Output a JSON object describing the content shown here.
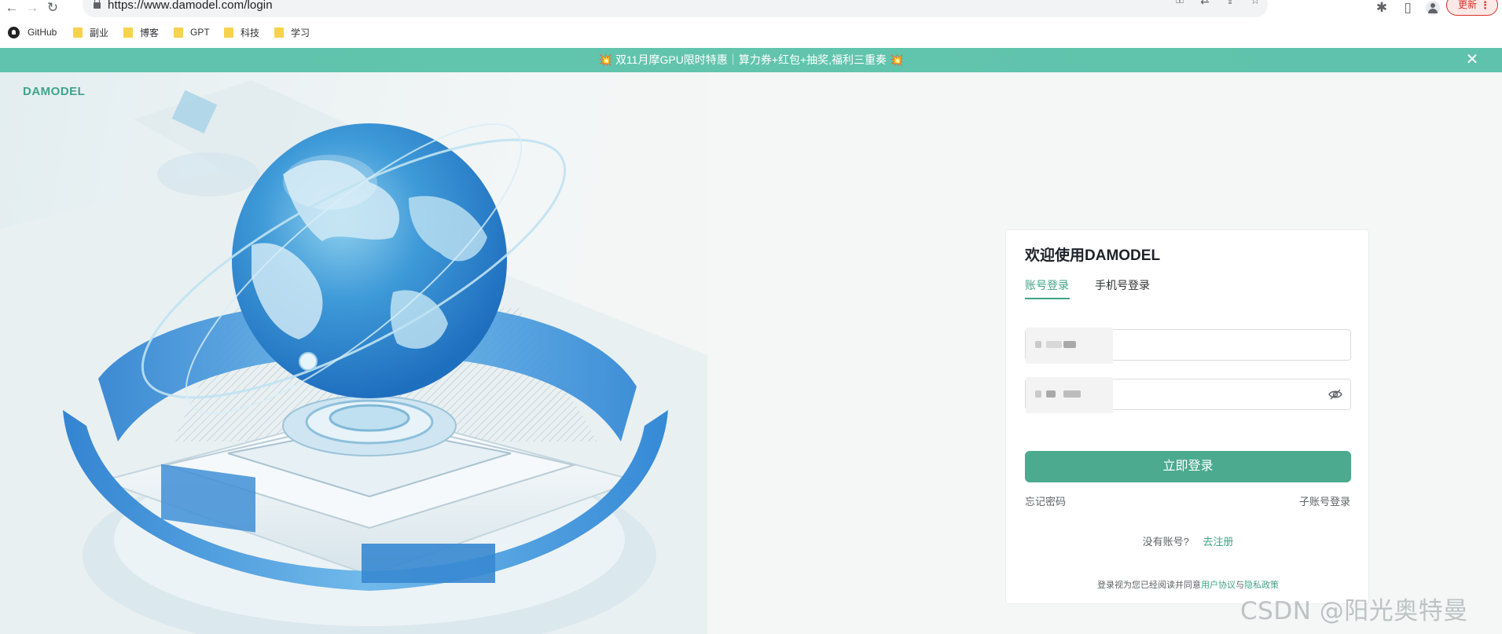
{
  "browser": {
    "url": "https://www.damodel.com/login",
    "update_label": "更新",
    "update_more": "⋮",
    "bookmarks": [
      {
        "label": "GitHub",
        "icon": "github-icon"
      },
      {
        "label": "副业",
        "icon": "folder-icon"
      },
      {
        "label": "博客",
        "icon": "folder-icon"
      },
      {
        "label": "GPT",
        "icon": "folder-icon"
      },
      {
        "label": "科技",
        "icon": "folder-icon"
      },
      {
        "label": "学习",
        "icon": "folder-icon"
      }
    ]
  },
  "banner": {
    "emoji": "💥",
    "text": "双11月摩GPU限时特惠｜算力券+红包+抽奖,福利三重奏",
    "close": "✕"
  },
  "brand": "DAMODEL",
  "login": {
    "title": "欢迎使用DAMODEL",
    "tabs": [
      {
        "label": "账号登录",
        "active": true
      },
      {
        "label": "手机号登录",
        "active": false
      }
    ],
    "submit": "立即登录",
    "forgot": "忘记密码",
    "sub_account": "子账号登录",
    "no_account": "没有账号?",
    "register": "去注册",
    "terms_prefix": "登录视为您已经阅读并同意",
    "terms_user": "用户协议",
    "terms_and": "与",
    "terms_privacy": "隐私政策"
  },
  "watermark": "CSDN @阳光奥特曼",
  "colors": {
    "accent": "#3fa486",
    "button": "#4caa8e",
    "banner": "#5fc3ad",
    "update_red": "#d93025"
  }
}
